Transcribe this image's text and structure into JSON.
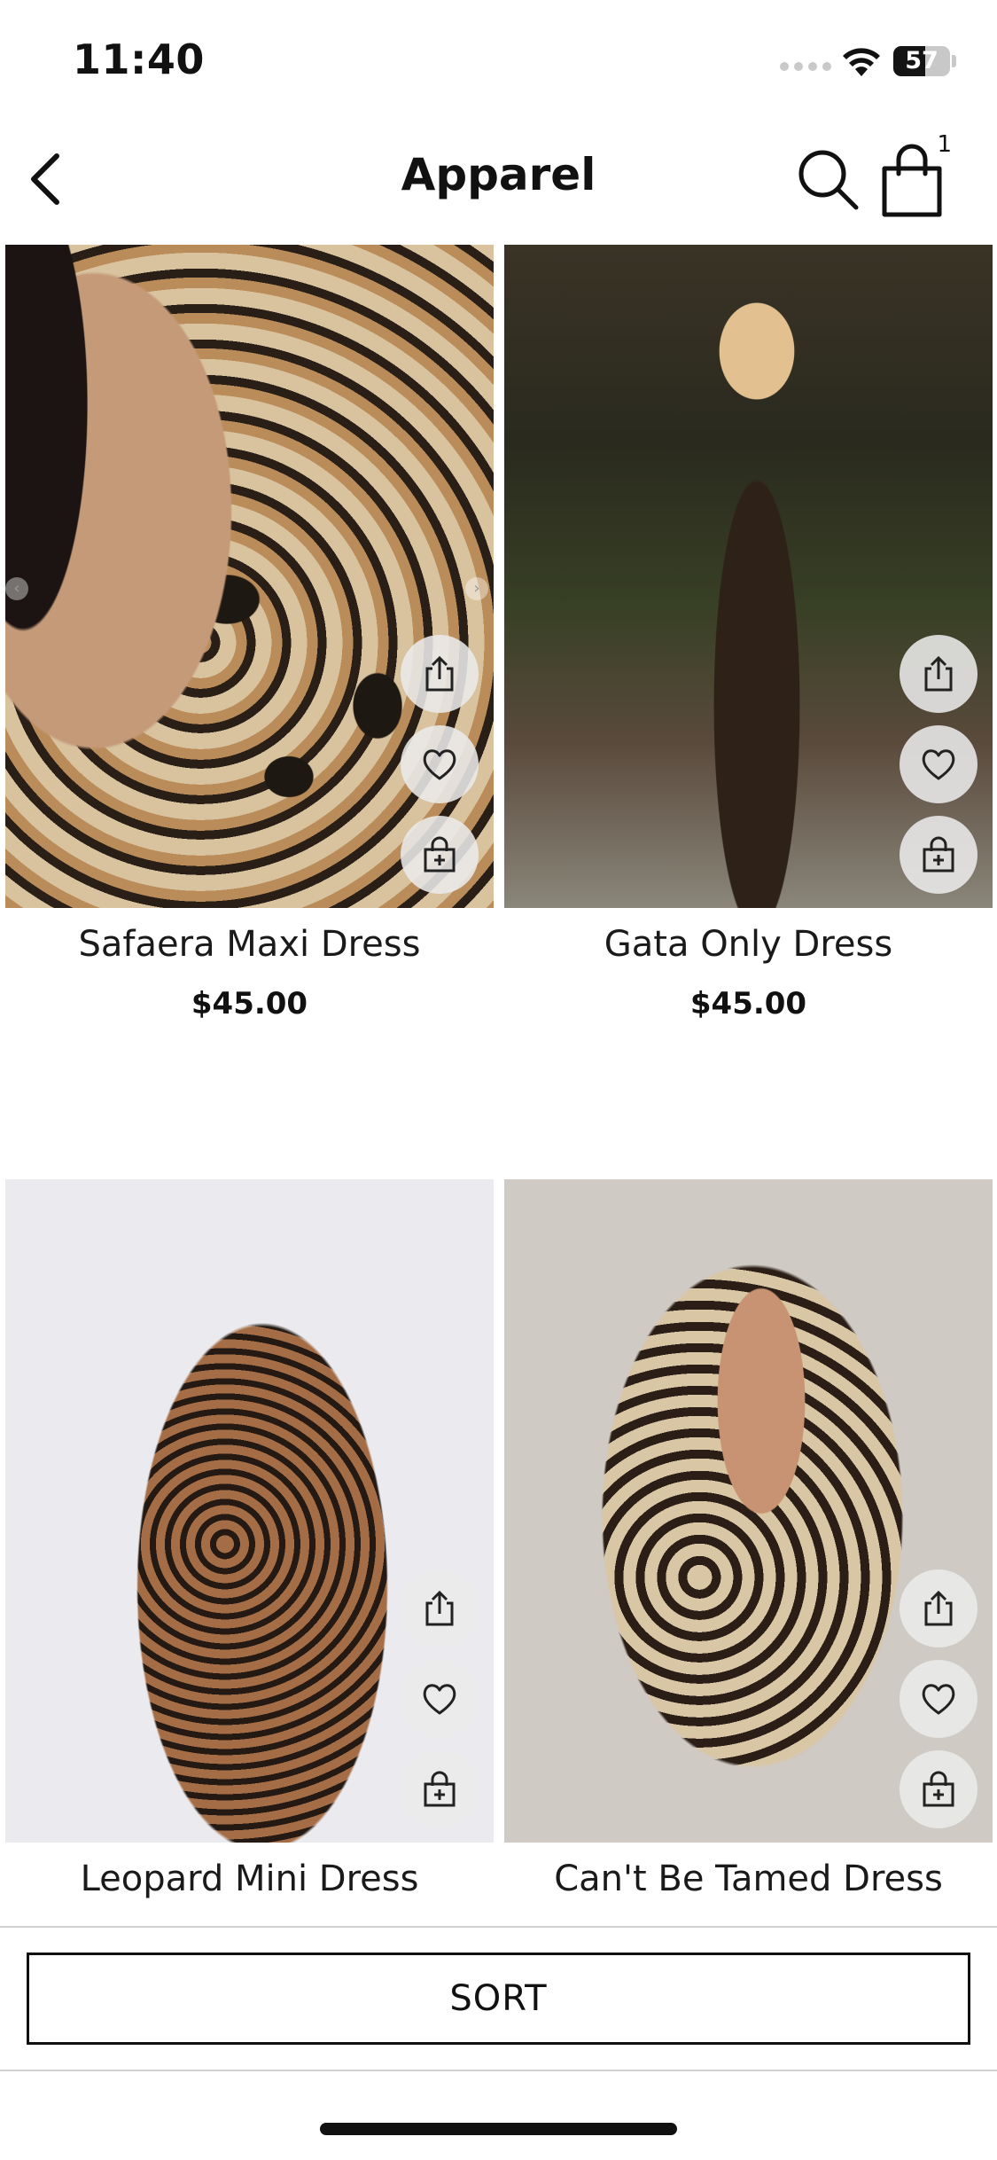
{
  "status_bar": {
    "time": "11:40",
    "battery_percent": 57,
    "battery_label": "57"
  },
  "nav": {
    "title": "Apparel",
    "cart_count": "1"
  },
  "products": [
    {
      "name": "Safaera Maxi Dress",
      "price": "$45.00"
    },
    {
      "name": "Gata Only Dress",
      "price": "$45.00"
    },
    {
      "name": "Leopard Mini Dress",
      "price": ""
    },
    {
      "name": "Can't Be Tamed Dress",
      "price": ""
    }
  ],
  "sort": {
    "label": "SORT"
  },
  "icons": {
    "back": "chevron-left-icon",
    "search": "search-icon",
    "cart": "shopping-bag-icon",
    "share": "share-icon",
    "wishlist": "heart-icon",
    "add_to_cart": "bag-plus-icon"
  }
}
